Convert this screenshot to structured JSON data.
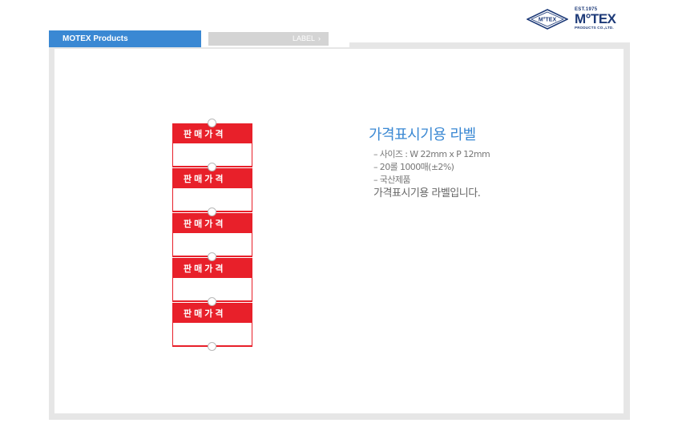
{
  "logo": {
    "mark": "M°TEX",
    "est": "EST.1975",
    "name": "M°TEX",
    "sub": "PRODUCTS CO.,LTD."
  },
  "tabs": {
    "main": "MOTEX Products",
    "sub": "LABEL",
    "sub_chevron": "›"
  },
  "labels": [
    {
      "text": "판매가격"
    },
    {
      "text": "판매가격"
    },
    {
      "text": "판매가격"
    },
    {
      "text": "판매가격"
    },
    {
      "text": "판매가격"
    }
  ],
  "product": {
    "title": "가격표시기용 라벨",
    "specs": [
      "– 사이즈 : W 22mm x P 12mm",
      "– 20롤 1000매(±2%)",
      "– 국산제품"
    ],
    "body": "가격표시기용 라벨입니다."
  },
  "colors": {
    "accent": "#3a88d3",
    "label_red": "#e8202a",
    "brand_navy": "#1d3a78",
    "frame_gray": "#e6e6e6"
  }
}
